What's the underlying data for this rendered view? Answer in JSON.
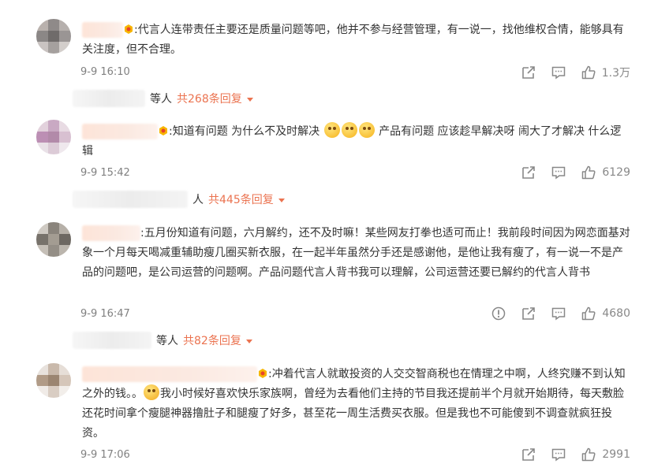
{
  "comments": [
    {
      "text": ":代言人连带责任主要还是质量问题等吧，他并不参与经营管理，有一说一，找他维权合情，能够具有关注度，但不合理。",
      "time": "9-9 16:10",
      "likes": "1.3万",
      "replies_who": "等人",
      "replies_count": "共268条回复"
    },
    {
      "text_before": ":知道有问题 为什么不及时解决",
      "text_after": "产品有问题 应该趁早解决呀 闹大了才解决 什么逻辑",
      "time": "9-9 15:42",
      "likes": "6129",
      "replies_who": "人",
      "replies_count": "共445条回复"
    },
    {
      "text": ":五月份知道有问题，六月解约，还不及时嘛！某些网友打拳也适可而止！我前段时间因为网恋面基对象一个月每天喝减重辅助瘦几圈买新衣服，在一起半年虽然分手还是感谢他，是他让我有瘦了，有一说一不是产品的问题吧，是公司运营的问题啊。产品问题代言人背书我可以理解，公司运营还要已解约的代言人背书",
      "time": "9-9 16:47",
      "likes": "4680",
      "replies_who": "等人",
      "replies_count": "共82条回复"
    },
    {
      "text_before": ":冲着代言人就敢投资的人交交智商税也在情理之中啊，人终究赚不到认知之外的钱。。",
      "text_after": "我小时候好喜欢快乐家族啊，曾经为去看他们主持的节目我还提前半个月就开始期待，每天敷脸还花时间拿个瘦腿神器撸肚子和腿瘦了好多，甚至花一周生活费买衣服。但是我也不可能傻到不调查就疯狂投资。",
      "time": "9-9 17:06",
      "likes": "2991"
    }
  ],
  "icons": [
    "share-icon",
    "comment-icon",
    "like-icon",
    "report-icon"
  ],
  "colors": {
    "accent": "#eb7350",
    "meta": "#808080",
    "text": "#333333"
  }
}
